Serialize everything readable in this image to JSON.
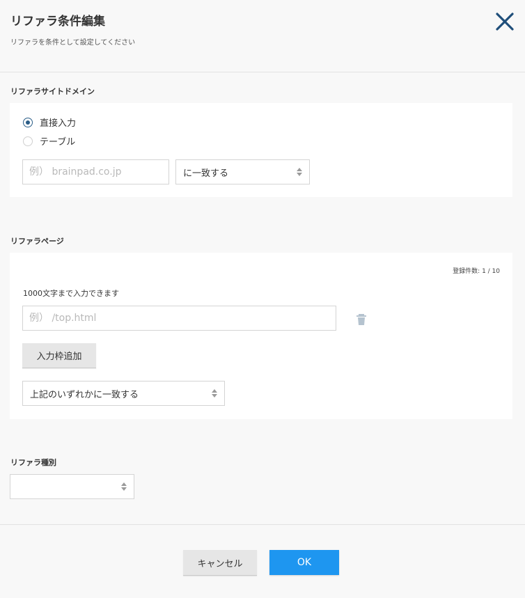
{
  "header": {
    "title": "リファラ条件編集",
    "subtitle": "リファラを条件として設定してください"
  },
  "referrer_domain": {
    "label": "リファラサイトドメイン",
    "radio_options": [
      "直接入力",
      "テーブル"
    ],
    "selected_option": "直接入力",
    "input_placeholder": "例） brainpad.co.jp",
    "input_value": "",
    "match_select": "に一致する"
  },
  "referrer_page": {
    "label": "リファラページ",
    "count_text": "登録件数: 1 / 10",
    "hint": "1000文字まで入力できます",
    "input_placeholder": "例） /top.html",
    "input_value": "",
    "add_button": "入力枠追加",
    "match_select": "上記のいずれかに一致する"
  },
  "referrer_type": {
    "label": "リファラ種別",
    "select_value": ""
  },
  "footer": {
    "cancel_label": "キャンセル",
    "ok_label": "OK"
  },
  "colors": {
    "accent": "#1e96f0",
    "close_icon": "#1f4e7a",
    "radio_checked": "#2a5d87"
  }
}
